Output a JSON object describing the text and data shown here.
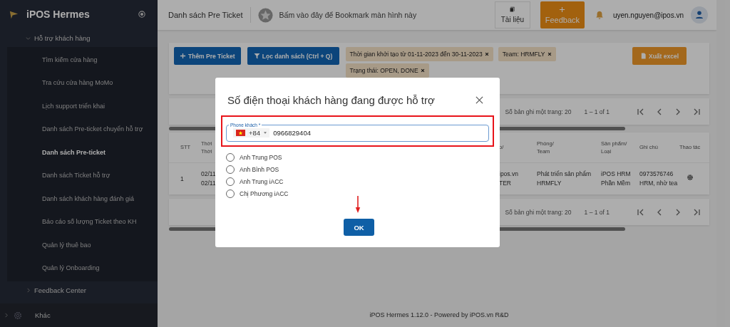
{
  "sidebar": {
    "brand": "iPOS Hermes",
    "groups": [
      {
        "label": "Hỗ trợ khách hàng",
        "kind": "group",
        "expanded": true,
        "children": [
          {
            "label": "Tìm kiếm cửa hàng",
            "selected": false
          },
          {
            "label": "Tra cứu cửa hàng MoMo",
            "selected": false
          },
          {
            "label": "Lịch support triển khai",
            "selected": false
          },
          {
            "label": "Danh sách Pre-ticket chuyển hỗ trợ",
            "selected": false
          },
          {
            "label": "Danh sách Pre-ticket",
            "selected": true
          },
          {
            "label": "Danh sách Ticket hỗ trợ",
            "selected": false
          },
          {
            "label": "Danh sách khách hàng đánh giá",
            "selected": false
          },
          {
            "label": "Báo cáo số lượng Ticket theo KH",
            "selected": false
          },
          {
            "label": "Quản lý thuê bao",
            "selected": false
          },
          {
            "label": "Quản lý Onboarding",
            "selected": false
          }
        ]
      },
      {
        "label": "Feedback Center",
        "kind": "group",
        "expanded": false
      },
      {
        "label": "Khác",
        "kind": "settings",
        "expanded": false
      }
    ]
  },
  "header": {
    "title": "Danh sách Pre Ticket",
    "bookmark": "Bấm vào đây để Bookmark màn hình này",
    "docs": "Tài liệu",
    "feedback": "Feedback",
    "user": "uyen.nguyen@ipos.vn"
  },
  "toolbar": {
    "add": "Thêm Pre Ticket",
    "filter": "Lọc danh sách (Ctrl + Q)",
    "export": "Xuất excel",
    "chips": [
      "Thời gian khởi tạo từ 01-11-2023 đến 30-11-2023",
      "Team: HRMFLY",
      "Trạng thái: OPEN, DONE"
    ]
  },
  "pagination": [
    {
      "page_size": "Số bản ghi một trang: 20",
      "range": "1 – 1 of 1"
    },
    {
      "page_size": "Số bản ghi một trang: 20",
      "range": "1 – 1 of 1"
    }
  ],
  "table": {
    "columns": [
      "STT",
      "Thời\nThời",
      "o/",
      "Phòng/\nTeam",
      "Sản phẩm/\nLoại",
      "Ghi chú",
      "Thao tác"
    ],
    "rows": [
      {
        "cells": [
          "1",
          "02/11\n02/11",
          "ipos.vn\nTER",
          "Phát triển sản phẩm\nHRMFLY",
          "iPOS HRM\nPhần Mềm",
          "0973576746\nHRM, nhờ tea"
        ]
      }
    ]
  },
  "dialog": {
    "title": "Số điện thoại khách hàng đang được hỗ trợ",
    "field": {
      "label": "Phone khách *",
      "code": "+84",
      "value": "0966829404"
    },
    "options": [
      {
        "label": "Anh Trung POS",
        "selected": false
      },
      {
        "label": "Anh Bình POS",
        "selected": false
      },
      {
        "label": "Anh Trung iACC",
        "selected": false
      },
      {
        "label": "Chị Phương iACC",
        "selected": false
      }
    ],
    "ok": "OK"
  },
  "footer": "iPOS Hermes 1.12.0 - Powered by iPOS.vn R&D"
}
